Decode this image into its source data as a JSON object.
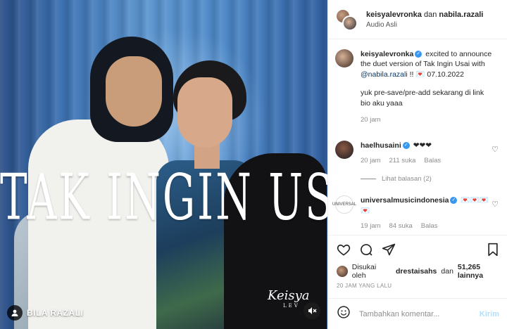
{
  "media": {
    "title_art": "TAK INGIN USAI",
    "user_tag": "BILA RAZALI",
    "signature": "Keisya",
    "signature_sub": "LEV"
  },
  "header": {
    "user1": "keisyalevronka",
    "joiner": "dan",
    "user2": "nabila.razali",
    "audio": "Audio Asli"
  },
  "caption": {
    "username": "keisyalevronka",
    "text_before_mention": "excited to announce the duet version of Tak Ingin Usai with",
    "mention": "@nabila.razali",
    "text_after_mention": "!! 💌 07.10.2022",
    "second_paragraph": "yuk pre-save/pre-add sekarang di link bio aku yaaa",
    "time": "20 jam"
  },
  "comments": [
    {
      "username": "haelhusaini",
      "text": "❤❤❤",
      "time": "20 jam",
      "likes": "211 suka",
      "reply": "Balas",
      "view_replies": "Lihat balasan (2)"
    },
    {
      "username": "universalmusicindonesia",
      "text": "💌💌💌💌",
      "time": "19 jam",
      "likes": "84 suka",
      "reply": "Balas",
      "avatar_text": "UNIVERSAL"
    }
  ],
  "likes": {
    "prefix": "Disukai oleh",
    "user": "drestaisahs",
    "joiner": "dan",
    "count": "51,265 lainnya"
  },
  "timestamp": "20 JAM YANG LALU",
  "comment_box": {
    "placeholder": "Tambahkan komentar...",
    "send": "Kirim"
  },
  "colors": {
    "verified": "#3897f0",
    "mention": "#00376b",
    "send_disabled": "#b2dffc"
  }
}
